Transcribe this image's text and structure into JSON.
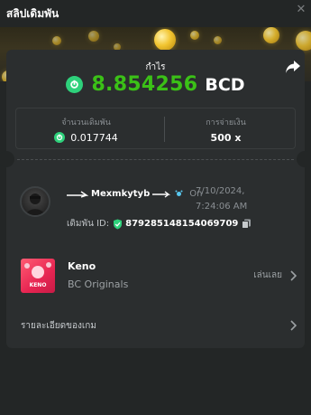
{
  "header": {
    "title": "สลิปเดิมพัน",
    "close_glyph": "✕"
  },
  "profit": {
    "label": "กำไร",
    "value": "8.854256",
    "currency": "BCD",
    "currency_icon": "bcd-coin-icon",
    "value_color": "#3bc117"
  },
  "stats": {
    "bet_amount_label": "จำนวนเดิมพัน",
    "bet_amount_value": "0.017744",
    "payout_label": "การจ่ายเงิน",
    "payout_value": "500 x"
  },
  "user": {
    "name": "Mexmkytyb",
    "on_text": "On",
    "date": "7/10/2024, 7:24:06 AM",
    "bet_id_label": "เดิมพัน ID:",
    "bet_id_value": "879285148154069709"
  },
  "game": {
    "name": "Keno",
    "provider": "BC Originals",
    "icon_label": "KENO",
    "play_label": "เล่นเลย"
  },
  "details": {
    "label": "รายละเอียดของเกม"
  },
  "colors": {
    "background": "#232626",
    "card": "#2b2e2f",
    "accent_green": "#3bc117",
    "bcd_logo": "#2ed17b"
  }
}
